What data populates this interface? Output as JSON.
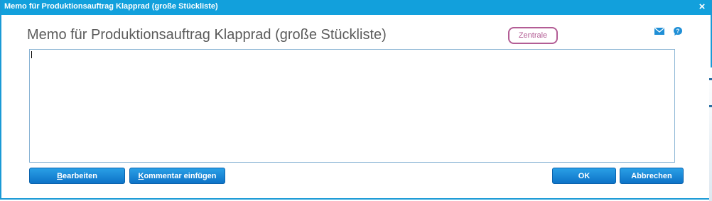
{
  "window": {
    "title": "Memo für Produktionsauftrag Klapprad (große Stückliste)",
    "close_glyph": "×"
  },
  "header": {
    "heading": "Memo für Produktionsauftrag Klapprad (große Stückliste)",
    "badge": "Zentrale",
    "badge_color": "#b35d95",
    "icons": [
      "mail-icon",
      "help-icon"
    ]
  },
  "memo": {
    "value": ""
  },
  "buttons": {
    "edit": {
      "mnemonic": "B",
      "rest": "earbeiten"
    },
    "comment": {
      "mnemonic": "K",
      "rest": "ommentar einfügen"
    },
    "ok": "OK",
    "cancel": "Abbrechen"
  },
  "colors": {
    "titlebar": "#12a0dc",
    "button": "#1a8ad8",
    "accent_border": "#8ab4d4"
  }
}
